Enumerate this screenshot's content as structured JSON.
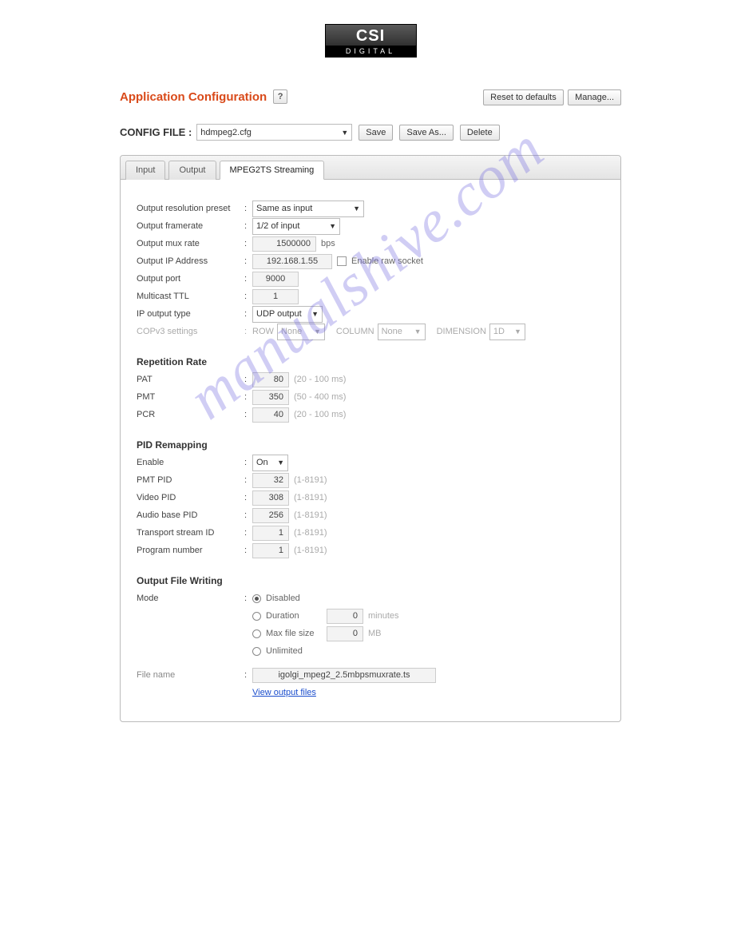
{
  "logo": {
    "top": "CSI",
    "bottom": "DIGITAL"
  },
  "header": {
    "title": "Application Configuration",
    "help": "?",
    "reset": "Reset to defaults",
    "manage": "Manage..."
  },
  "config": {
    "label": "CONFIG FILE :",
    "file": "hdmpeg2.cfg",
    "save": "Save",
    "saveAs": "Save As...",
    "delete": "Delete"
  },
  "tabs": {
    "input": "Input",
    "output": "Output",
    "mpeg2ts": "MPEG2TS Streaming"
  },
  "form": {
    "outRes": {
      "label": "Output resolution preset",
      "value": "Same as input"
    },
    "outFps": {
      "label": "Output framerate",
      "value": "1/2 of input"
    },
    "outMux": {
      "label": "Output mux rate",
      "value": "1500000",
      "unit": "bps"
    },
    "outIp": {
      "label": "Output IP Address",
      "value": "192.168.1.55",
      "checklabel": "Enable raw socket"
    },
    "outPort": {
      "label": "Output port",
      "value": "9000"
    },
    "ttl": {
      "label": "Multicast TTL",
      "value": "1"
    },
    "ipType": {
      "label": "IP output type",
      "value": "UDP output"
    },
    "cop": {
      "label": "COPv3 settings",
      "row": "ROW",
      "rowVal": "None",
      "col": "COLUMN",
      "colVal": "None",
      "dim": "DIMENSION",
      "dimVal": "1D"
    }
  },
  "rep": {
    "title": "Repetition Rate",
    "pat": {
      "label": "PAT",
      "value": "80",
      "hint": "(20 - 100 ms)"
    },
    "pmt": {
      "label": "PMT",
      "value": "350",
      "hint": "(50 - 400 ms)"
    },
    "pcr": {
      "label": "PCR",
      "value": "40",
      "hint": "(20 - 100 ms)"
    }
  },
  "pid": {
    "title": "PID Remapping",
    "enable": {
      "label": "Enable",
      "value": "On"
    },
    "pmt": {
      "label": "PMT PID",
      "value": "32",
      "hint": "(1-8191)"
    },
    "video": {
      "label": "Video PID",
      "value": "308",
      "hint": "(1-8191)"
    },
    "audio": {
      "label": "Audio base PID",
      "value": "256",
      "hint": "(1-8191)"
    },
    "tsid": {
      "label": "Transport stream ID",
      "value": "1",
      "hint": "(1-8191)"
    },
    "prog": {
      "label": "Program number",
      "value": "1",
      "hint": "(1-8191)"
    }
  },
  "ofw": {
    "title": "Output File Writing",
    "modeLabel": "Mode",
    "disabled": "Disabled",
    "duration": "Duration",
    "durationVal": "0",
    "durationUnit": "minutes",
    "maxSize": "Max file size",
    "maxSizeVal": "0",
    "maxSizeUnit": "MB",
    "unlimited": "Unlimited",
    "fnameLabel": "File name",
    "fname": "igolgi_mpeg2_2.5mbpsmuxrate.ts",
    "link": "View output files"
  },
  "watermark": "manualshive.com"
}
